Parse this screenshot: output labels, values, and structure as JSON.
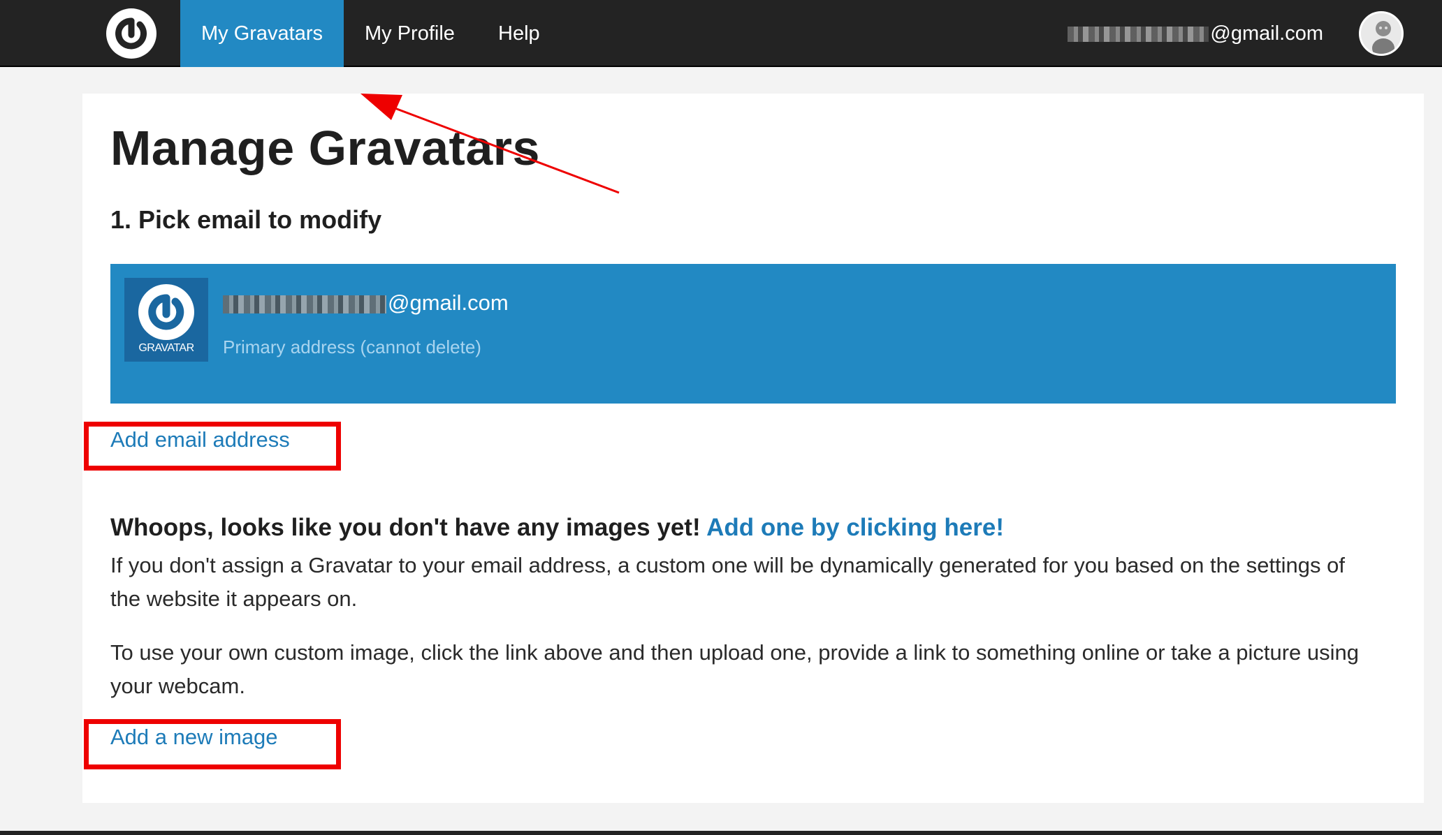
{
  "nav": {
    "items": [
      {
        "label": "My Gravatars"
      },
      {
        "label": "My Profile"
      },
      {
        "label": "Help"
      }
    ],
    "user_email_suffix": "@gmail.com"
  },
  "main": {
    "title": "Manage Gravatars",
    "step_title": "1. Pick email to modify",
    "email_panel": {
      "logo_text": "GRAVATAR",
      "email_suffix": "@gmail.com",
      "subtitle": "Primary address (cannot delete)"
    },
    "add_email_label": "Add email address",
    "no_images_heading": "Whoops, looks like you don't have any images yet!",
    "no_images_link": "Add one by clicking here!",
    "paragraph1": "If you don't assign a Gravatar to your email address, a custom one will be dynamically generated for you based on the settings of the website it appears on.",
    "paragraph2": "To use your own custom image, click the link above and then upload one, provide a link to something online or take a picture using your webcam.",
    "add_image_label": "Add a new image"
  },
  "colors": {
    "topbar": "#232323",
    "accent": "#2289c3",
    "link": "#1d7bb8",
    "annotation": "#ee0000"
  }
}
